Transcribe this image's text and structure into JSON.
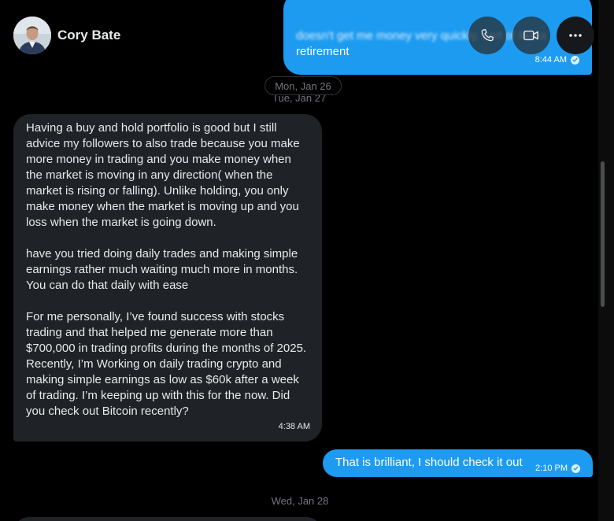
{
  "header": {
    "contact_name": "Cory Bate",
    "call_icon": "phone-icon",
    "video_icon": "video-camera-icon",
    "more_icon": "more-horizontal-icon"
  },
  "messages": {
    "top_outgoing": {
      "line1": "doesn't get me money very quickly, sort of like a",
      "line2": "retirement",
      "time": "8:44 AM"
    },
    "main_incoming": {
      "paragraph1": "Having a buy and hold portfolio is good but I still advice my followers to also trade because you make more money in trading and you make money when the market is moving in any direction( when the market is rising or falling). Unlike holding, you only make money when the market is moving up and you loss when the market is going down.",
      "paragraph2": "have you tried doing daily trades and making simple earnings rather much waiting much more in months. You can do that daily with ease",
      "paragraph3": "For me personally, I’ve found success with stocks trading and that helped me generate more than $700,000 in trading profits during the months of 2025.",
      "paragraph4": "Recently, I’m Working on daily trading crypto and making simple earnings as low as $60k after a week of trading. I’m keeping up with this for the now. Did you check out Bitcoin recently?",
      "time": "4:38 AM"
    },
    "reply_outgoing": {
      "text": "That is brilliant, I should check it out",
      "time": "2:10 PM"
    }
  },
  "dates": {
    "pill": "Mon, Jan 26",
    "behind": "Tue, Jan 27",
    "bottom": "Wed, Jan 28"
  },
  "colors": {
    "outgoing_bubble": "#1d9bf0",
    "incoming_bubble": "#1f2327",
    "background": "#000000",
    "muted_text": "#71767b"
  }
}
